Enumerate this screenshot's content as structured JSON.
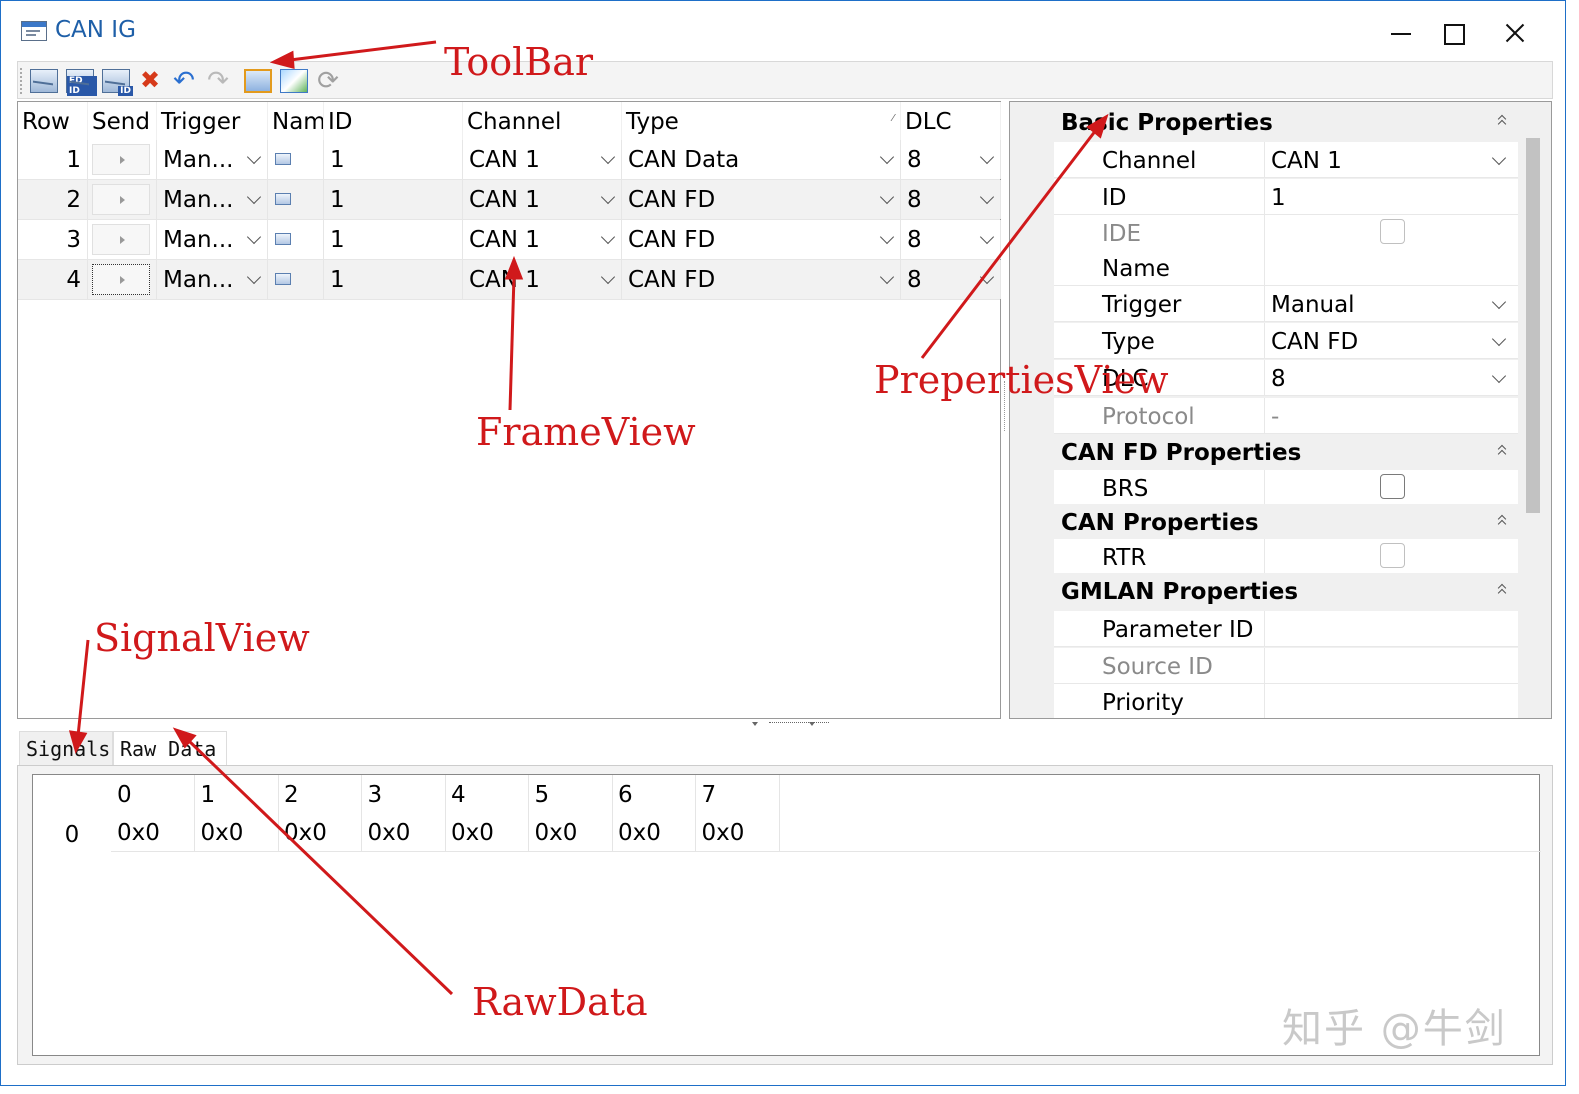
{
  "window": {
    "title": "CAN IG"
  },
  "toolbar": {
    "icons": [
      "new-can-frame-icon",
      "new-canfd-frame-icon",
      "new-can-id-frame-icon",
      "delete-icon",
      "undo-icon",
      "redo-icon",
      "panel-icon",
      "image-icon",
      "refresh-icon"
    ],
    "tags": {
      "fd": "FD ID",
      "id": "ID"
    },
    "glyphs": {
      "delete": "✖",
      "undo": "↶",
      "redo": "↷",
      "refresh": "⟳"
    }
  },
  "frame_view": {
    "columns": [
      "Row",
      "Send",
      "Trigger",
      "Nam",
      "ID",
      "Channel",
      "Type",
      "DLC"
    ],
    "sort_glyph": "⁄",
    "rows": [
      {
        "row": "1",
        "trigger": "Man...",
        "id": "1",
        "channel": "CAN 1",
        "type": "CAN Data",
        "dlc": "8"
      },
      {
        "row": "2",
        "trigger": "Man...",
        "id": "1",
        "channel": "CAN 1",
        "type": "CAN FD",
        "dlc": "8"
      },
      {
        "row": "3",
        "trigger": "Man...",
        "id": "1",
        "channel": "CAN 1",
        "type": "CAN FD",
        "dlc": "8"
      },
      {
        "row": "4",
        "trigger": "Man...",
        "id": "1",
        "channel": "CAN 1",
        "type": "CAN FD",
        "dlc": "8"
      }
    ]
  },
  "properties": {
    "basic": {
      "title": "Basic Properties",
      "channel": {
        "label": "Channel",
        "value": "CAN 1"
      },
      "id": {
        "label": "ID",
        "value": "1"
      },
      "ide": {
        "label": "IDE",
        "checked": false
      },
      "name": {
        "label": "Name",
        "value": ""
      },
      "trigger": {
        "label": "Trigger",
        "value": "Manual"
      },
      "type": {
        "label": "Type",
        "value": "CAN FD"
      },
      "dlc": {
        "label": "DLC",
        "value": "8"
      },
      "protocol": {
        "label": "Protocol",
        "value": "-"
      }
    },
    "canfd": {
      "title": "CAN FD Properties",
      "brs": {
        "label": "BRS",
        "checked": false
      }
    },
    "can": {
      "title": "CAN Properties",
      "rtr": {
        "label": "RTR",
        "checked": false
      }
    },
    "gmlan": {
      "title": "GMLAN Properties",
      "parameter_id": {
        "label": "Parameter ID",
        "value": ""
      },
      "source_id": {
        "label": "Source ID",
        "value": ""
      },
      "priority": {
        "label": "Priority",
        "value": ""
      }
    }
  },
  "tabs": [
    {
      "label": "Signals",
      "active": false
    },
    {
      "label": "Raw Data",
      "active": true
    }
  ],
  "raw_data": {
    "row_label": "0",
    "columns": [
      "0",
      "1",
      "2",
      "3",
      "4",
      "5",
      "6",
      "7"
    ],
    "values": [
      "0x0",
      "0x0",
      "0x0",
      "0x0",
      "0x0",
      "0x0",
      "0x0",
      "0x0"
    ]
  },
  "annotations": {
    "toolbar": "ToolBar",
    "frame_view": "FrameView",
    "properties_view": "PrepertiesView",
    "signal_view": "SignalView",
    "raw_data": "RawData"
  },
  "annotation_color": "#d0191b",
  "watermark": "知乎 @牛剑"
}
